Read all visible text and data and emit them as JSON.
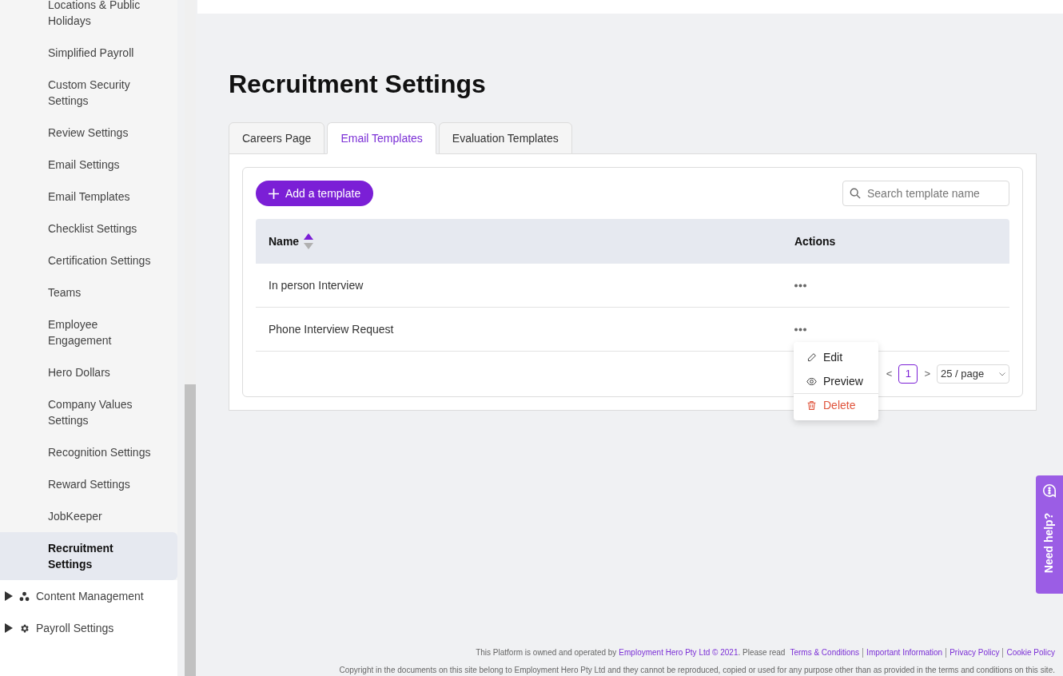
{
  "sidebar": {
    "items": [
      {
        "label": "Locations & Public Holidays",
        "selected": false
      },
      {
        "label": "Simplified Payroll",
        "selected": false
      },
      {
        "label": "Custom Security Settings",
        "selected": false
      },
      {
        "label": "Review Settings",
        "selected": false
      },
      {
        "label": "Email Settings",
        "selected": false
      },
      {
        "label": "Email Templates",
        "selected": false
      },
      {
        "label": "Checklist Settings",
        "selected": false
      },
      {
        "label": "Certification Settings",
        "selected": false
      },
      {
        "label": "Teams",
        "selected": false
      },
      {
        "label": "Employee Engagement",
        "selected": false
      },
      {
        "label": "Hero Dollars",
        "selected": false
      },
      {
        "label": "Company Values Settings",
        "selected": false
      },
      {
        "label": "Recognition Settings",
        "selected": false
      },
      {
        "label": "Reward Settings",
        "selected": false
      },
      {
        "label": "JobKeeper",
        "selected": false
      },
      {
        "label": "Recruitment Settings",
        "selected": true
      }
    ],
    "sections": [
      {
        "label": "Content Management",
        "kind": "content",
        "expanded": false
      },
      {
        "label": "Payroll Settings",
        "kind": "gear",
        "expanded": false
      }
    ]
  },
  "page": {
    "title": "Recruitment Settings"
  },
  "tabs": [
    {
      "label": "Careers Page",
      "selected": false
    },
    {
      "label": "Email Templates",
      "selected": true
    },
    {
      "label": "Evaluation Templates",
      "selected": false
    }
  ],
  "add_button": "Add a template",
  "search": {
    "placeholder": "Search template name"
  },
  "table": {
    "columns": [
      {
        "label": "Name",
        "sorted": true
      },
      {
        "label": "Actions",
        "sorted": false
      }
    ],
    "rows": [
      {
        "name": "In person Interview"
      },
      {
        "name": "Phone Interview Request",
        "menu": [
          {
            "label": "Edit",
            "kind": "edit"
          },
          {
            "label": "Preview",
            "kind": "preview"
          },
          {
            "label": "Delete",
            "kind": "delete"
          }
        ]
      }
    ]
  },
  "pagination": {
    "prev": "<",
    "pages": [
      {
        "label": "1",
        "selected": true
      }
    ],
    "next": ">",
    "page_size": "25 / page"
  },
  "footer": {
    "line1": [
      {
        "text": "This Platform is owned and operated by",
        "kind": "text"
      },
      {
        "text": "Employment Hero Pty Ltd © 2021",
        "kind": "link"
      },
      {
        "text": ". Please read",
        "kind": "text"
      },
      {
        "text": "Terms & Conditions",
        "kind": "link"
      },
      {
        "text": "Important Information",
        "kind": "link"
      },
      {
        "text": "Privacy Policy",
        "kind": "link"
      },
      {
        "text": "Cookie Policy",
        "kind": "link"
      }
    ],
    "line2": "Copyright in the documents on this site belong to Employment Hero Pty Ltd and they cannot be reproduced, copied or used for any purpose other than as provided in the terms and conditions on this site."
  },
  "help_tab": "Need help?"
}
